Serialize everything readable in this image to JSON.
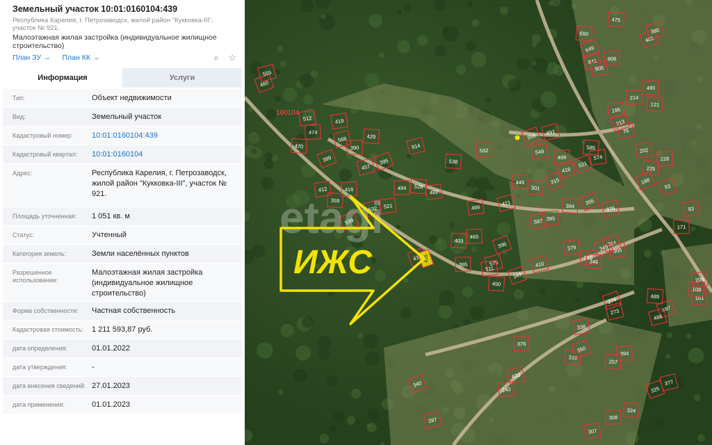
{
  "card": {
    "title": "Земельный участок 10:01:0160104:439",
    "address_small": "Республика Карелия, г. Петрозаводск, жилой район \"Кукковка-III\", участок № 921.",
    "use": "Малоэтажная жилая застройка (индивидуальное жилищное строительство)",
    "links": [
      "План ЗУ →",
      "План КК →"
    ],
    "tabs": [
      "Информация",
      "Услуги"
    ]
  },
  "rows": [
    {
      "label": "Тип:",
      "value": "Объект недвижимости"
    },
    {
      "label": "Вид:",
      "value": "Земельный участок"
    },
    {
      "label": "Кадастровый номер:",
      "value": "10:01:0160104:439",
      "link": true
    },
    {
      "label": "Кадастровый квартал:",
      "value": "10:01:0160104",
      "link": true
    },
    {
      "label": "Адрес:",
      "value": "Республика Карелия, г. Петрозаводск, жилой район \"Кукковка-III\", участок № 921."
    },
    {
      "label": "Площадь уточненная:",
      "value": "1 051 кв. м"
    },
    {
      "label": "Статус:",
      "value": "Учтенный"
    },
    {
      "label": "Категория земель:",
      "value": "Земли населённых пунктов"
    },
    {
      "label": "Разрешенное использование:",
      "value": "Малоэтажная жилая застройка (индивидуальное жилищное строительство)"
    },
    {
      "label": "Форма собственности:",
      "value": "Частная собственность"
    },
    {
      "label": "Кадастровая стоимость:",
      "value": "1 211 593,87 руб."
    },
    {
      "label": "дата определения:",
      "value": "01.01.2022"
    },
    {
      "label": "дата утверждения:",
      "value": "-"
    },
    {
      "label": "дата внесения сведений:",
      "value": "27.01.2023"
    },
    {
      "label": "дата применения:",
      "value": "01.01.2023"
    }
  ],
  "map": {
    "overlay_label": "ИЖС",
    "watermark": "etagi",
    "quarter_label": "160104",
    "selected_parcel": "439",
    "colors": {
      "parcel": "#e8313a",
      "highlight": "#f2e300",
      "forest": "#2c4a22"
    },
    "parcels": [
      "460",
      "555",
      "512",
      "474",
      "470",
      "389",
      "568",
      "419",
      "390",
      "429",
      "395",
      "457",
      "412",
      "416",
      "359",
      "539",
      "532",
      "521",
      "494",
      "528",
      "439",
      "914",
      "482",
      "532",
      "538",
      "359",
      "891",
      "549",
      "499",
      "585",
      "521",
      "418",
      "574",
      "445",
      "301",
      "315",
      "421",
      "466",
      "465",
      "403",
      "396",
      "575",
      "511",
      "395",
      "450",
      "349",
      "410",
      "587",
      "395",
      "384",
      "355",
      "376",
      "379",
      "315",
      "346",
      "349",
      "364",
      "305",
      "490",
      "650",
      "649",
      "841",
      "805",
      "806",
      "475",
      "481",
      "380",
      "195",
      "214",
      "121",
      "213",
      "76",
      "202",
      "228",
      "225",
      "188",
      "93",
      "83",
      "171",
      "489",
      "497",
      "488",
      "209",
      "151",
      "109",
      "274",
      "273",
      "338",
      "376",
      "319",
      "350",
      "433",
      "240",
      "394",
      "257",
      "340",
      "287",
      "307",
      "308",
      "324",
      "325",
      "377"
    ]
  }
}
